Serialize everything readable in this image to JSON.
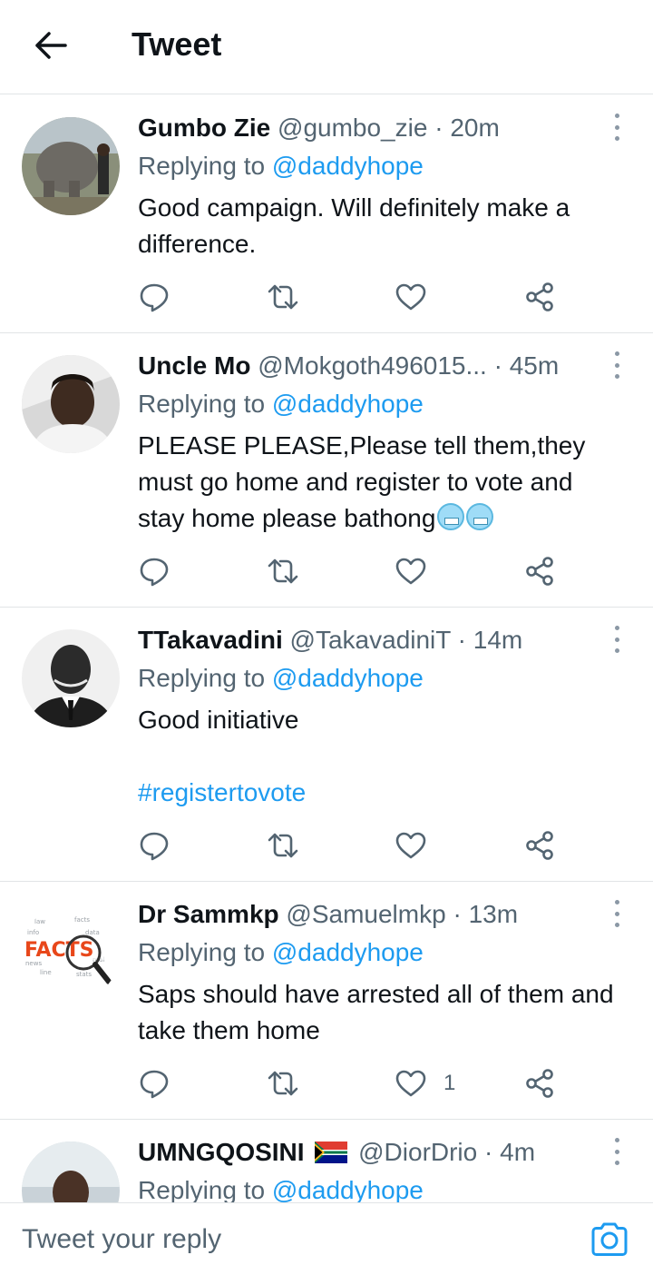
{
  "header": {
    "title": "Tweet"
  },
  "tweets": [
    {
      "name": "Gumbo Zie",
      "handle": "@gumbo_zie",
      "dot": "·",
      "time": "20m",
      "replying_prefix": "Replying to",
      "replying_to": "@daddyhope",
      "text": "Good campaign. Will definitely make a difference.",
      "like_count": ""
    },
    {
      "name": "Uncle Mo",
      "handle": "@Mokgoth496015...",
      "dot": "·",
      "time": "45m",
      "replying_prefix": "Replying to",
      "replying_to": "@daddyhope",
      "text": "PLEASE PLEASE,Please tell them,they must go home and register to vote and stay home please bathong",
      "emoji": "cold-face-emoji",
      "like_count": ""
    },
    {
      "name": "TTakavadini",
      "handle": "@TakavadiniT",
      "dot": "·",
      "time": "14m",
      "replying_prefix": "Replying to",
      "replying_to": "@daddyhope",
      "text": "Good initiative",
      "hashtag": "#registertovote",
      "like_count": ""
    },
    {
      "name": "Dr Sammkp",
      "handle": "@Samuelmkp",
      "dot": "·",
      "time": "13m",
      "replying_prefix": "Replying to",
      "replying_to": "@daddyhope",
      "text": "Saps should have arrested all of them and take them home",
      "like_count": "1"
    },
    {
      "name": "UMNGQOSINI",
      "flag": "south-africa-flag",
      "handle": "@DiorDrio",
      "dot": "·",
      "time": "4m",
      "replying_prefix": "Replying to",
      "replying_to": "@daddyhope"
    }
  ],
  "reply_bar": {
    "placeholder": "Tweet your reply"
  },
  "colors": {
    "accent": "#1d9bf0",
    "muted": "#536471",
    "text": "#0f1419",
    "divider": "#e1e4e6"
  },
  "icons": [
    "back-arrow-icon",
    "more-vertical-icon",
    "reply-icon",
    "retweet-icon",
    "heart-icon",
    "share-icon",
    "camera-icon"
  ]
}
